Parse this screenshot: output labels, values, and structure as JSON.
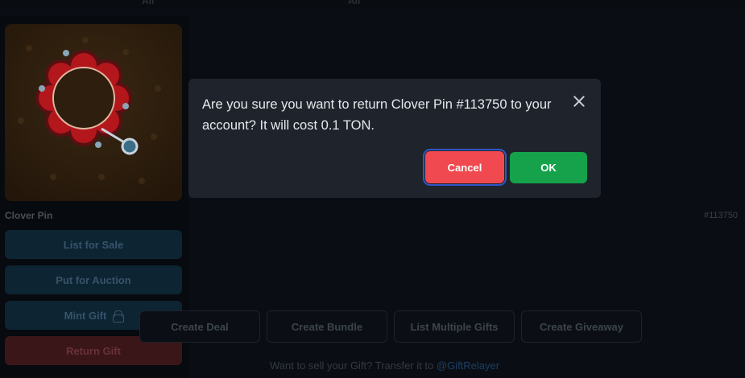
{
  "top_tabs": [
    "All",
    "All"
  ],
  "card": {
    "name": "Clover Pin",
    "number": "#113750",
    "buttons": {
      "list_for_sale": "List for Sale",
      "put_for_auction": "Put for Auction",
      "mint_gift": "Mint Gift",
      "return_gift": "Return Gift"
    }
  },
  "actions": [
    "Create Deal",
    "Create Bundle",
    "List Multiple Gifts",
    "Create Giveaway"
  ],
  "footer": {
    "text": "Want to sell your Gift? Transfer it to ",
    "link": "@GiftRelayer"
  },
  "modal": {
    "message": "Are you sure you want to return Clover Pin #113750 to your account? It will cost 0.1 TON.",
    "cancel_label": "Cancel",
    "ok_label": "OK"
  },
  "colors": {
    "cancel": "#f0494f",
    "ok": "#15a24b",
    "modal_bg": "#1f242c"
  },
  "icons": {
    "close": "close-icon",
    "lock": "lock-icon"
  }
}
